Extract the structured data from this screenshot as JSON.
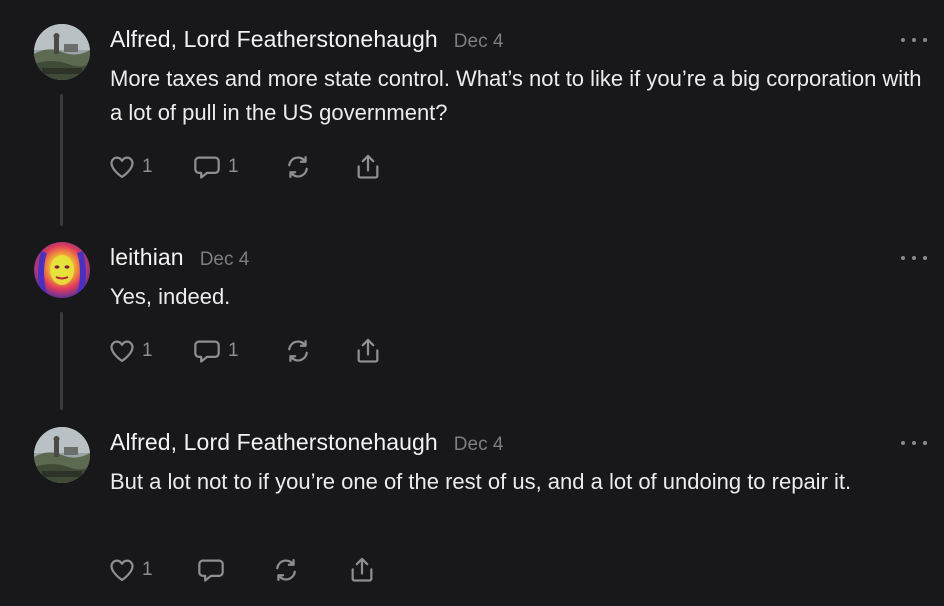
{
  "posts": [
    {
      "author": "Alfred, Lord Featherstonehaugh",
      "date": "Dec 4",
      "text": "More taxes and more state control. What’s not to like if you’re a big corporation with a lot of pull in the US government?",
      "likes": "1",
      "replies": "1",
      "avatar": "landscape-statue-avatar",
      "more_icon": "more-dots-icon"
    },
    {
      "author": "leithian",
      "date": "Dec 4",
      "text": "Yes, indeed.",
      "likes": "1",
      "replies": "1",
      "avatar": "colorful-portrait-avatar",
      "more_icon": "more-dots-icon"
    },
    {
      "author": "Alfred, Lord Featherstonehaugh",
      "date": "Dec 4",
      "text": "But a lot not to if you’re one of the rest of us, and a lot of undoing to repair it.",
      "likes": "1",
      "replies": "",
      "avatar": "landscape-statue-avatar",
      "more_icon": "more-dots-icon"
    }
  ],
  "colors": {
    "background": "#18181b",
    "text": "#f3f3f3",
    "muted": "#7d7d82",
    "icon": "#8e8e93",
    "thread_line": "#3a3a3d"
  },
  "icons": [
    "heart-icon",
    "comment-icon",
    "repost-icon",
    "share-icon",
    "more-dots-icon"
  ]
}
